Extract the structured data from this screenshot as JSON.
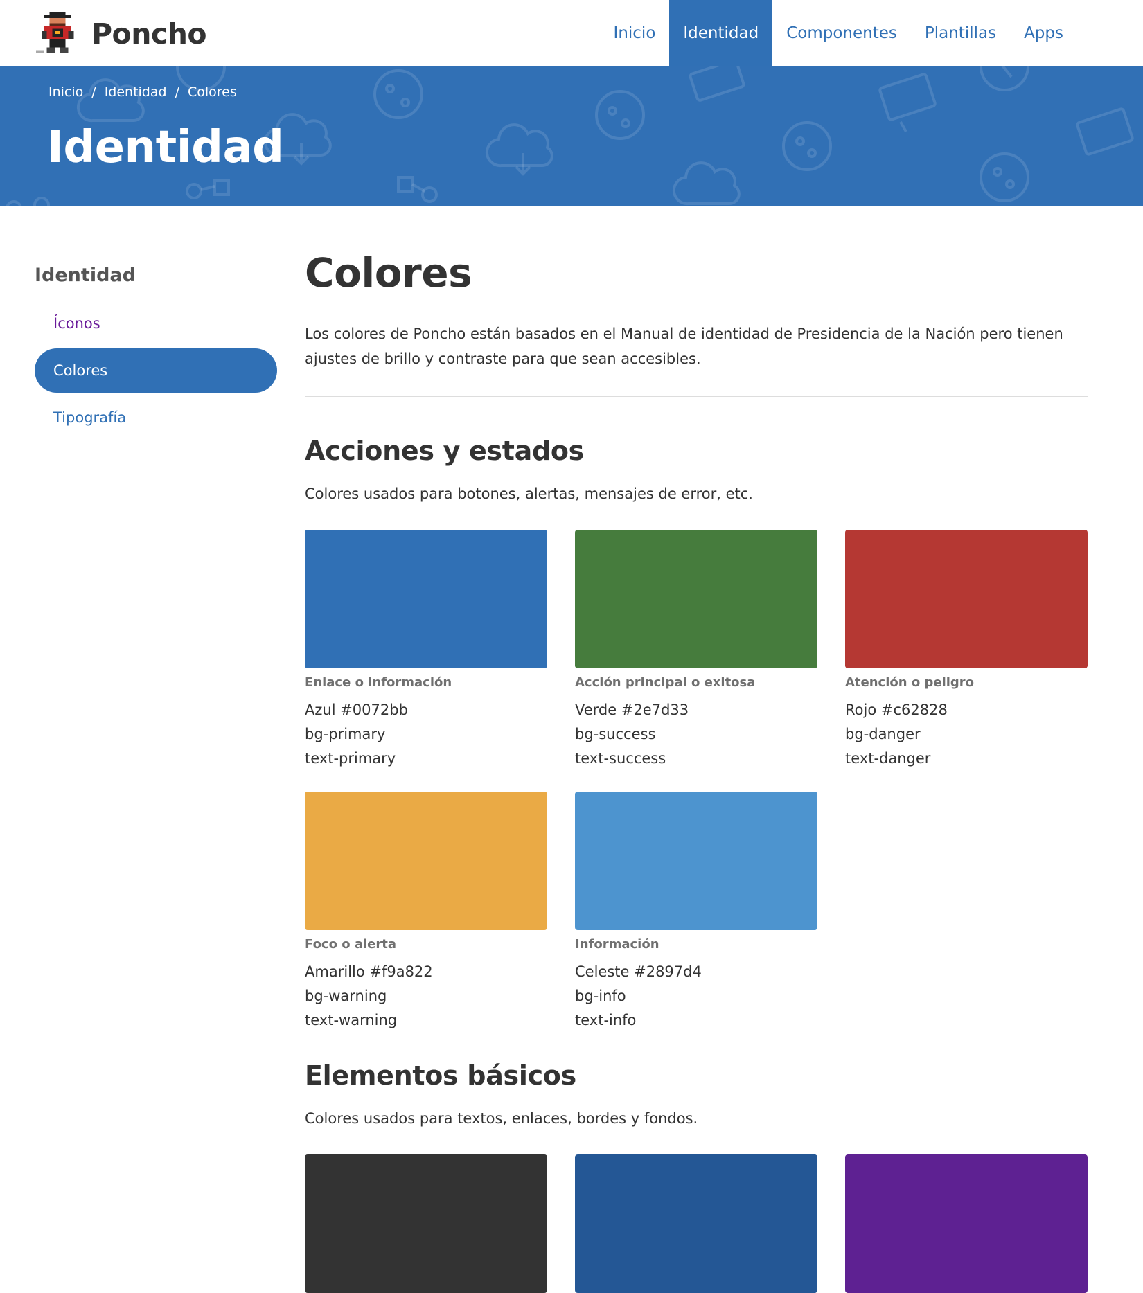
{
  "brand": {
    "name": "Poncho",
    "logo_icon": "poncho-gaucho-logo-icon"
  },
  "nav": {
    "items": [
      {
        "label": "Inicio",
        "active": false
      },
      {
        "label": "Identidad",
        "active": true
      },
      {
        "label": "Componentes",
        "active": false
      },
      {
        "label": "Plantillas",
        "active": false
      },
      {
        "label": "Apps",
        "active": false
      }
    ]
  },
  "hero": {
    "breadcrumb": [
      "Inicio",
      "Identidad",
      "Colores"
    ],
    "separator": "/",
    "title": "Identidad",
    "background": "#3170b5"
  },
  "sidebar": {
    "heading": "Identidad",
    "items": [
      {
        "label": "Íconos",
        "state": "visited"
      },
      {
        "label": "Colores",
        "state": "active"
      },
      {
        "label": "Tipografía",
        "state": "link"
      }
    ]
  },
  "main": {
    "title": "Colores",
    "intro": "Los colores de Poncho están basados en el Manual de identidad de Presidencia de la Nación pero tienen ajustes de brillo y contraste para que sean accesibles.",
    "sections": [
      {
        "title": "Acciones y estados",
        "description": "Colores usados para botones, alertas, mensajes de error, etc.",
        "swatches": [
          {
            "label": "Enlace o información",
            "name": "Azul #0072bb",
            "bg_class": "bg-primary",
            "text_class": "text-primary",
            "display_color": "#3070b5"
          },
          {
            "label": "Acción principal o exitosa",
            "name": "Verde #2e7d33",
            "bg_class": "bg-success",
            "text_class": "text-success",
            "display_color": "#467c3d"
          },
          {
            "label": "Atención o peligro",
            "name": "Rojo #c62828",
            "bg_class": "bg-danger",
            "text_class": "text-danger",
            "display_color": "#b53833"
          },
          {
            "label": "Foco o alerta",
            "name": "Amarillo #f9a822",
            "bg_class": "bg-warning",
            "text_class": "text-warning",
            "display_color": "#eaaa45"
          },
          {
            "label": "Información",
            "name": "Celeste #2897d4",
            "bg_class": "bg-info",
            "text_class": "text-info",
            "display_color": "#4d94cf"
          }
        ]
      },
      {
        "title": "Elementos básicos",
        "description": "Colores usados para textos, enlaces, bordes y fondos.",
        "swatches": [
          {
            "display_color": "#333333"
          },
          {
            "display_color": "#245795"
          },
          {
            "display_color": "#5e2192"
          }
        ]
      }
    ]
  },
  "colors": {
    "brand_blue": "#3070b5",
    "visited_purple": "#6a1b9a",
    "text_dark": "#333333",
    "label_gray": "#707070"
  }
}
